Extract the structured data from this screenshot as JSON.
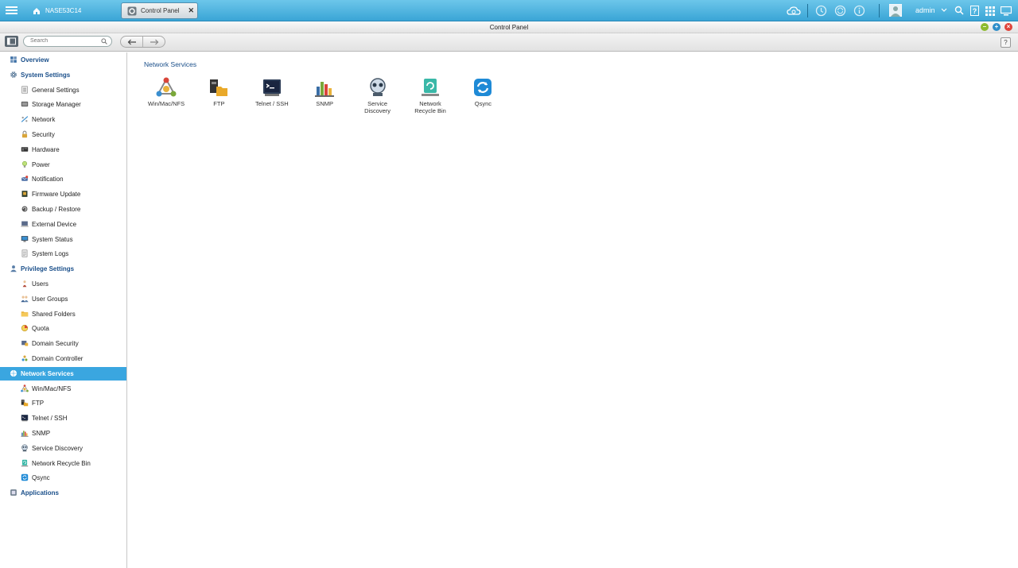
{
  "topbar": {
    "nas_name": "NASE53C14",
    "tab_title": "Control Panel",
    "user": "admin"
  },
  "window": {
    "title": "Control Panel",
    "help": "?"
  },
  "search": {
    "placeholder": "Search"
  },
  "sidebar": {
    "items": [
      {
        "label": "Overview",
        "kind": "cat",
        "icon": "overview-icon"
      },
      {
        "label": "System Settings",
        "kind": "cat",
        "icon": "gear-icon"
      },
      {
        "label": "General Settings",
        "kind": "sub",
        "icon": "general-settings-icon"
      },
      {
        "label": "Storage Manager",
        "kind": "sub",
        "icon": "storage-icon"
      },
      {
        "label": "Network",
        "kind": "sub",
        "icon": "network-icon"
      },
      {
        "label": "Security",
        "kind": "sub",
        "icon": "lock-icon"
      },
      {
        "label": "Hardware",
        "kind": "sub",
        "icon": "hardware-icon"
      },
      {
        "label": "Power",
        "kind": "sub",
        "icon": "power-bulb-icon"
      },
      {
        "label": "Notification",
        "kind": "sub",
        "icon": "notification-icon"
      },
      {
        "label": "Firmware Update",
        "kind": "sub",
        "icon": "firmware-icon"
      },
      {
        "label": "Backup / Restore",
        "kind": "sub",
        "icon": "backup-icon"
      },
      {
        "label": "External Device",
        "kind": "sub",
        "icon": "external-device-icon"
      },
      {
        "label": "System Status",
        "kind": "sub",
        "icon": "monitor-icon"
      },
      {
        "label": "System Logs",
        "kind": "sub",
        "icon": "logs-icon"
      },
      {
        "label": "Privilege Settings",
        "kind": "cat",
        "icon": "user-icon"
      },
      {
        "label": "Users",
        "kind": "sub",
        "icon": "users-icon"
      },
      {
        "label": "User Groups",
        "kind": "sub",
        "icon": "user-groups-icon"
      },
      {
        "label": "Shared Folders",
        "kind": "sub",
        "icon": "folder-icon"
      },
      {
        "label": "Quota",
        "kind": "sub",
        "icon": "quota-icon"
      },
      {
        "label": "Domain Security",
        "kind": "sub",
        "icon": "domain-security-icon"
      },
      {
        "label": "Domain Controller",
        "kind": "sub",
        "icon": "domain-controller-icon"
      },
      {
        "label": "Network Services",
        "kind": "cat",
        "icon": "network-services-icon",
        "active": true
      },
      {
        "label": "Win/Mac/NFS",
        "kind": "sub",
        "icon": "winmacnfs-icon"
      },
      {
        "label": "FTP",
        "kind": "sub",
        "icon": "ftp-icon"
      },
      {
        "label": "Telnet / SSH",
        "kind": "sub",
        "icon": "terminal-icon"
      },
      {
        "label": "SNMP",
        "kind": "sub",
        "icon": "snmp-icon"
      },
      {
        "label": "Service Discovery",
        "kind": "sub",
        "icon": "service-discovery-icon"
      },
      {
        "label": "Network Recycle Bin",
        "kind": "sub",
        "icon": "recycle-bin-icon"
      },
      {
        "label": "Qsync",
        "kind": "sub",
        "icon": "qsync-icon"
      },
      {
        "label": "Applications",
        "kind": "cat",
        "icon": "applications-icon"
      }
    ]
  },
  "main": {
    "section_title": "Network Services",
    "services": [
      {
        "line1": "Win/Mac/NFS",
        "line2": "",
        "icon": "winmacnfs-icon"
      },
      {
        "line1": "FTP",
        "line2": "",
        "icon": "ftp-icon"
      },
      {
        "line1": "Telnet / SSH",
        "line2": "",
        "icon": "terminal-icon"
      },
      {
        "line1": "SNMP",
        "line2": "",
        "icon": "snmp-icon"
      },
      {
        "line1": "Service",
        "line2": "Discovery",
        "icon": "service-discovery-icon"
      },
      {
        "line1": "Network",
        "line2": "Recycle Bin",
        "icon": "recycle-bin-icon"
      },
      {
        "line1": "Qsync",
        "line2": "",
        "icon": "qsync-icon"
      }
    ]
  },
  "colors": {
    "topbar": "#3aa5d6",
    "active_item": "#3aa6e0",
    "category_text": "#1a4f8a"
  }
}
